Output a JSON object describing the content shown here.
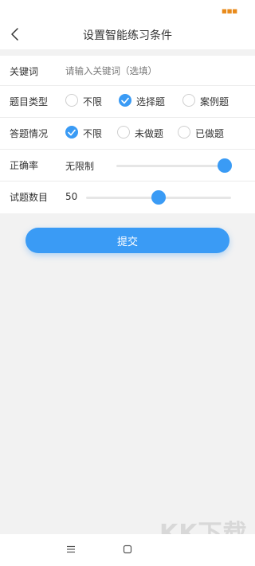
{
  "status_bar": {
    "badge": "■■■"
  },
  "header": {
    "title": "设置智能练习条件"
  },
  "form": {
    "keyword": {
      "label": "关键词",
      "placeholder": "请输入关键词（选填）",
      "value": ""
    },
    "question_type": {
      "label": "题目类型",
      "options": [
        {
          "label": "不限",
          "checked": false
        },
        {
          "label": "选择题",
          "checked": true
        },
        {
          "label": "案例题",
          "checked": false
        }
      ]
    },
    "answer_status": {
      "label": "答题情况",
      "options": [
        {
          "label": "不限",
          "checked": true
        },
        {
          "label": "未做题",
          "checked": false
        },
        {
          "label": "已做题",
          "checked": false
        }
      ]
    },
    "accuracy": {
      "label": "正确率",
      "value": "无限制",
      "slider_fraction": 1.0
    },
    "question_count": {
      "label": "试题数目",
      "value": "50",
      "slider_fraction": 0.5
    }
  },
  "submit_label": "提交",
  "watermark": {
    "logo": "KK下载",
    "url": "www.kkx.net"
  },
  "colors": {
    "accent": "#3a9bf5",
    "background": "#f2f2f2"
  }
}
